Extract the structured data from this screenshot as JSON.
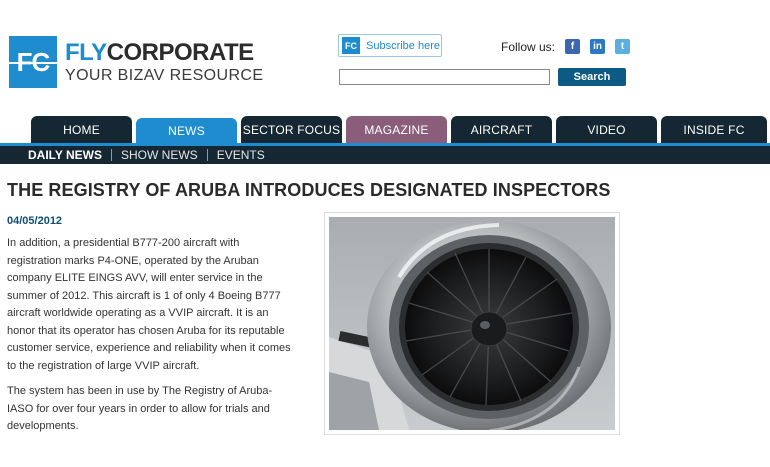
{
  "header": {
    "logo_mark": "FC",
    "logo_fly": "FLY",
    "logo_corporate": "CORPORATE",
    "logo_tagline": "YOUR BIZAV RESOURCE",
    "subscribe_icon_text": "FC",
    "subscribe_label": "Subscribe here",
    "follow_label": "Follow us:",
    "social": [
      {
        "name": "facebook",
        "glyph": "f"
      },
      {
        "name": "linkedin",
        "glyph": "in"
      },
      {
        "name": "twitter",
        "glyph": "t"
      }
    ],
    "search_value": "",
    "search_button": "Search"
  },
  "nav": {
    "tabs": [
      {
        "label": "HOME"
      },
      {
        "label": "NEWS"
      },
      {
        "label": "SECTOR FOCUS"
      },
      {
        "label": "MAGAZINE"
      },
      {
        "label": "AIRCRAFT"
      },
      {
        "label": "VIDEO"
      },
      {
        "label": "INSIDE FC"
      }
    ],
    "active_tab": "NEWS"
  },
  "subnav": {
    "items": [
      {
        "label": "DAILY NEWS"
      },
      {
        "label": "SHOW NEWS"
      },
      {
        "label": "EVENTS"
      }
    ],
    "active_item": "DAILY NEWS"
  },
  "article": {
    "headline": "THE REGISTRY OF ARUBA INTRODUCES DESIGNATED INSPECTORS",
    "date": "04/05/2012",
    "paragraph1": "In addition, a presidential B777-200 aircraft with registration marks P4-ONE, operated by the Aruban company ELITE EINGS AVV, will enter service in the summer of 2012. This aircraft is 1 of only 4 Boeing B777 aircraft worldwide operating as a VVIP aircraft. It is an honor that its operator has chosen Aruba for its reputable customer service, experience and reliability when it comes to the registration of large VVIP aircraft.",
    "paragraph2": "The system has been in use by The Registry of Aruba-IASO for over four years in order to allow for trials and developments."
  },
  "colors": {
    "brand_blue": "#1e8ccf",
    "nav_dark": "#142733",
    "magazine_tab": "#8a5e7a",
    "search_button": "#0d5b84"
  }
}
